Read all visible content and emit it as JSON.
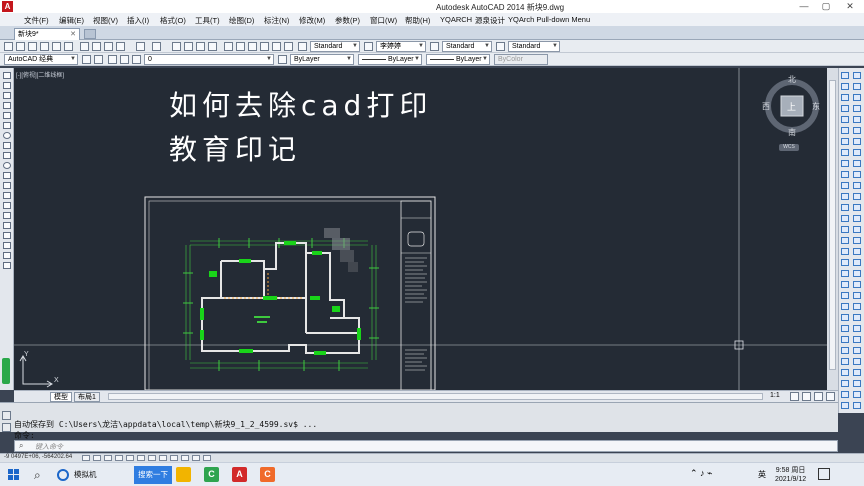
{
  "window": {
    "title": "Autodesk AutoCAD 2014    新块9.dwg",
    "logo_letter": "A",
    "controls": [
      "—",
      "▢",
      "✕"
    ]
  },
  "menu": [
    "文件(F)",
    "编辑(E)",
    "视图(V)",
    "插入(I)",
    "格式(O)",
    "工具(T)",
    "绘图(D)",
    "标注(N)",
    "修改(M)",
    "参数(P)",
    "窗口(W)",
    "帮助(H)",
    "YQARCH",
    "源泉设计",
    "YQArch Pull-down Menu"
  ],
  "doc_tab": {
    "label": "新块9*",
    "close": "✕"
  },
  "toolbar1": {
    "text_style": "Standard",
    "font_combo": "李婷婷",
    "dim_style": "Standard",
    "table_style": "Standard"
  },
  "toolbar2": {
    "workspace": "AutoCAD 经典",
    "layer": "0",
    "color": "ByLayer",
    "linetype": "ByLayer",
    "lineweight": "ByLayer",
    "plotstyle": "ByColor"
  },
  "viewport_label": "[-][俯视][二维线框]",
  "annotation": {
    "line1": "如何去除cad打印",
    "line2": "教育印记"
  },
  "viewcube": {
    "north": "北",
    "south": "南",
    "east": "东",
    "west": "西",
    "face": "上",
    "wcs": "WCS"
  },
  "ucs": {
    "y": "Y",
    "x": "X"
  },
  "layout_tabs": [
    "模型",
    "布局1"
  ],
  "scale_label": "1:1",
  "command": {
    "history": "自动保存到 C:\\Users\\龙洁\\appdata\\local\\temp\\新块9_1_2_4599.sv$ ...",
    "prompt": "命令:",
    "placeholder": "键入命令"
  },
  "status": {
    "coords": "-9 0497E+06, -564202.64"
  },
  "taskbar": {
    "browser": "模拟机",
    "search_button": "搜索一下",
    "clock_time": "9:58 周日",
    "clock_date": "2021/9/12",
    "ime": "英"
  },
  "colors": {
    "canvas": "#242b35",
    "drawing_green": "#19d419",
    "walls": "#e6e6e6",
    "dims": "#3ec93e"
  }
}
